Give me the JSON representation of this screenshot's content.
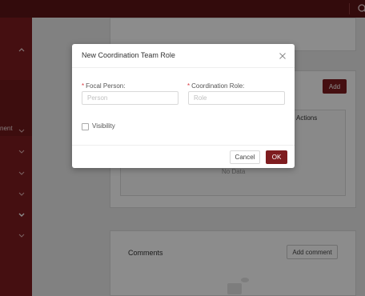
{
  "sidebar": {
    "partial_label": "nent"
  },
  "main": {
    "add_button": "Add",
    "table_header_actions": "Actions",
    "no_data": "No Data",
    "comments_title": "Comments",
    "add_comment_button": "Add comment"
  },
  "modal": {
    "title": "New Coordination Team Role",
    "focal_person": {
      "label": "Focal Person:",
      "placeholder": "Person"
    },
    "coordination_role": {
      "label": "Coordination Role:",
      "placeholder": "Role"
    },
    "visibility": {
      "label": "Visibility",
      "checked": false
    },
    "cancel_button": "Cancel",
    "ok_button": "OK"
  },
  "colors": {
    "brand": "#7e1c1f",
    "topbar": "#5e1416",
    "required": "#d9363e"
  },
  "icons": [
    "search-icon",
    "chevron-up-icon",
    "chevron-down-icon",
    "close-icon"
  ]
}
